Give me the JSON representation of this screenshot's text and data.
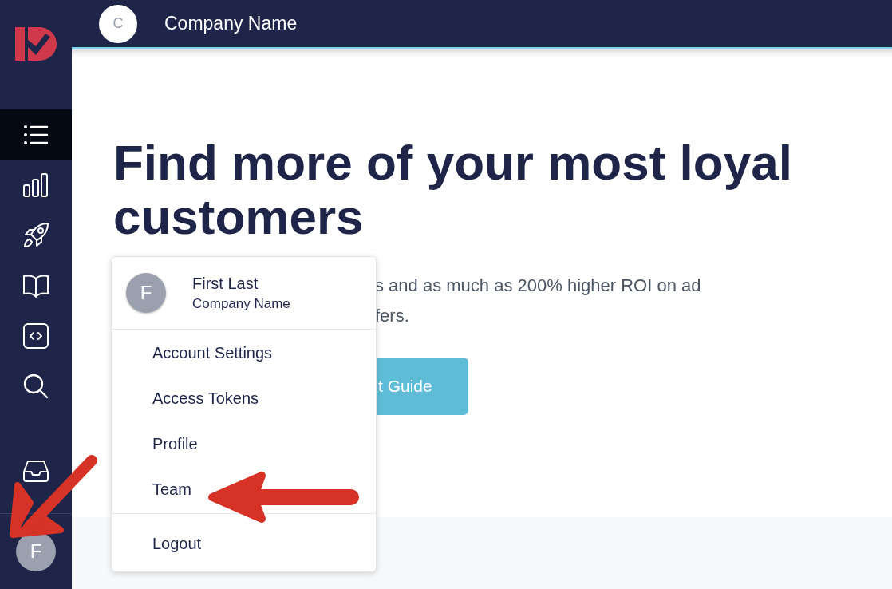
{
  "topbar": {
    "company_initial": "C",
    "company_name": "Company Name"
  },
  "sidebar": {
    "items": [
      {
        "selected": true
      },
      {
        "selected": false
      },
      {
        "selected": false
      },
      {
        "selected": false
      },
      {
        "selected": false
      },
      {
        "selected": false
      }
    ],
    "bottom_items": [
      {
        "selected": false
      }
    ],
    "user_initial": "F"
  },
  "main": {
    "heading": "Find more of your most loyal customers",
    "paragraph_lines": [
      "s and as much as 200% higher ROI on ad",
      "fers."
    ],
    "button": "t Guide"
  },
  "user_menu": {
    "initial": "F",
    "name": "First Last",
    "company": "Company Name",
    "items": [
      "Account Settings",
      "Access Tokens",
      "Profile",
      "Team"
    ],
    "footer_items": [
      "Logout"
    ]
  }
}
